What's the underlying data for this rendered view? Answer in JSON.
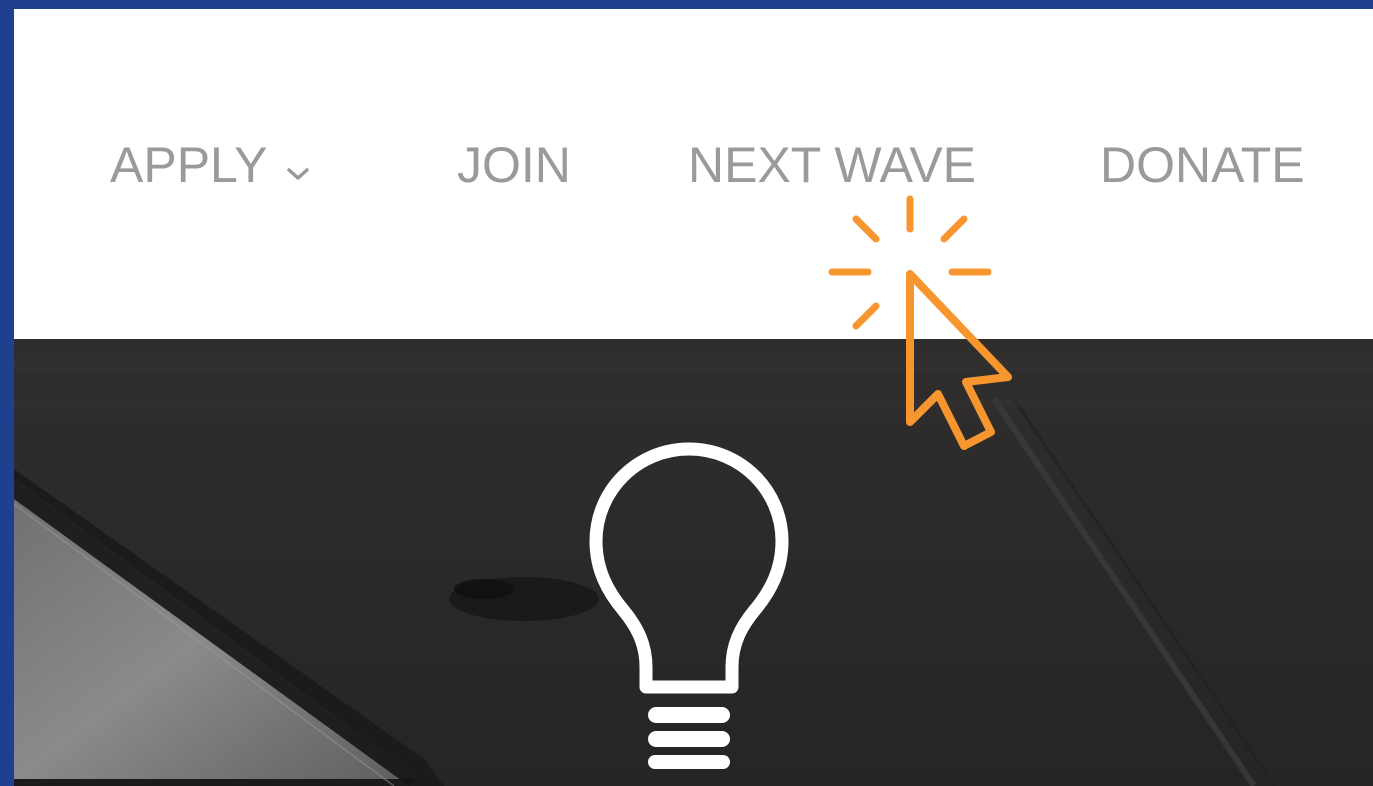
{
  "nav": {
    "items": [
      {
        "label": "APPLY",
        "has_dropdown": true
      },
      {
        "label": "JOIN",
        "has_dropdown": false
      },
      {
        "label": "NEXT WAVE",
        "has_dropdown": false
      },
      {
        "label": "DONATE",
        "has_dropdown": false
      }
    ]
  },
  "hero": {
    "icon": "lightbulb-icon"
  },
  "overlay": {
    "icon": "click-cursor-icon",
    "accent_color": "#f7962f"
  },
  "colors": {
    "frame": "#1f3f8f",
    "nav_text": "#9a9a9a",
    "hero_bg": "#2b2929"
  }
}
